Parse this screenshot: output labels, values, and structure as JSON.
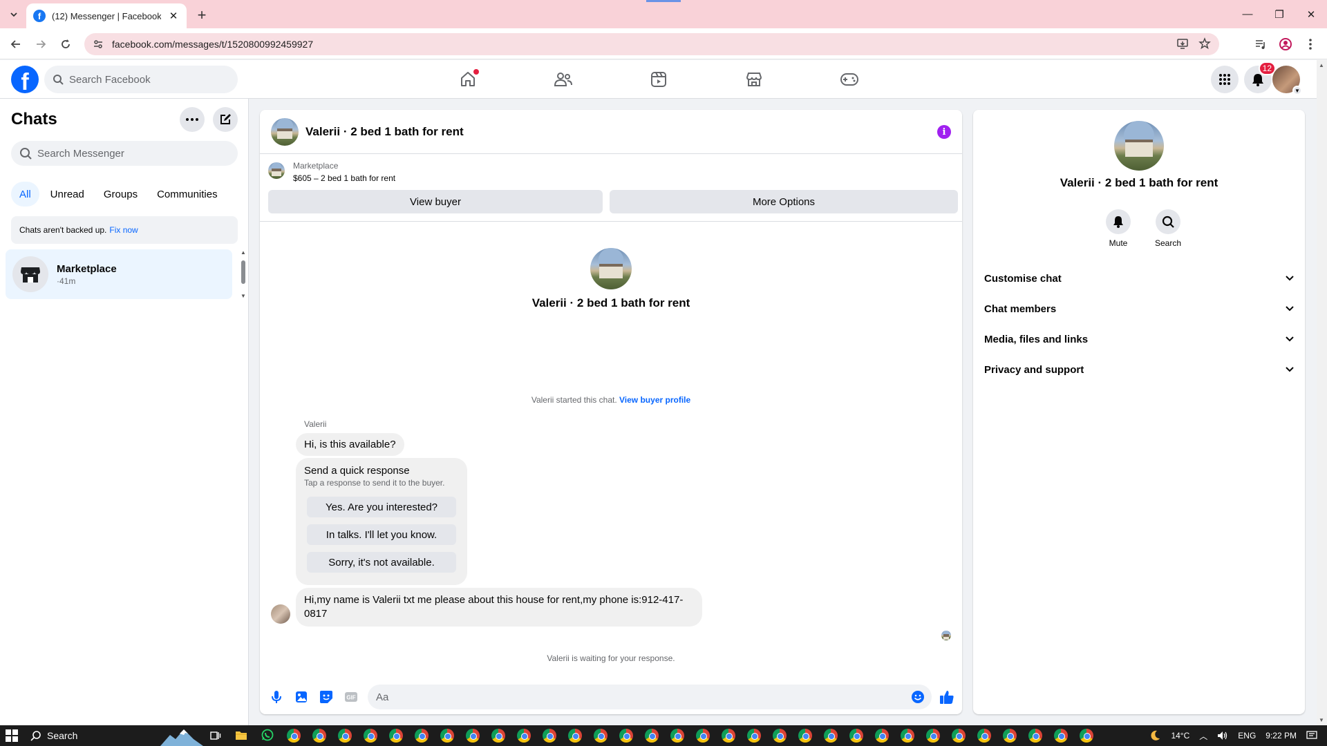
{
  "browser": {
    "tab_title": "(12) Messenger | Facebook",
    "url": "facebook.com/messages/t/1520800992459927"
  },
  "header": {
    "search_placeholder": "Search Facebook",
    "notifications_count": "12",
    "accent_color": "#0866ff",
    "nav_icons": [
      "home-icon",
      "friends-icon",
      "video-icon",
      "marketplace-icon",
      "gaming-icon"
    ]
  },
  "sidebar": {
    "title": "Chats",
    "search_placeholder": "Search Messenger",
    "filters": [
      "All",
      "Unread",
      "Groups",
      "Communities"
    ],
    "backup_text": "Chats aren't backed up.",
    "backup_link": "Fix now",
    "chats": [
      {
        "name": "Marketplace",
        "time": "·41m"
      }
    ]
  },
  "conversation": {
    "title": "Valerii · 2 bed 1 bath for rent",
    "marketplace_label": "Marketplace",
    "listing": "$605 – 2 bed 1 bath for rent",
    "view_buyer": "View buyer",
    "more_options": "More Options",
    "intro_name": "Valerii · 2 bed 1 bath for rent",
    "started_text": "Valerii started this chat.",
    "started_link": "View buyer profile",
    "sender": "Valerii",
    "message1": "Hi, is this available?",
    "quick_title": "Send a quick response",
    "quick_subtitle": "Tap a response to send it to the buyer.",
    "quick_responses": [
      "Yes. Are you interested?",
      "In talks. I'll let you know.",
      "Sorry, it's not available."
    ],
    "message2": "Hi,my name is Valerii txt me please about this house for rent,my phone is:912-417-0817",
    "waiting_text": "Valerii is waiting for your response.",
    "input_placeholder": "Aa"
  },
  "details": {
    "name": "Valerii · 2 bed 1 bath for rent",
    "actions": [
      "Mute",
      "Search"
    ],
    "sections": [
      "Customise chat",
      "Chat members",
      "Media, files and links",
      "Privacy and support"
    ]
  },
  "taskbar": {
    "search_label": "Search",
    "temperature": "14°C",
    "language": "ENG",
    "time": "9:22 PM"
  }
}
